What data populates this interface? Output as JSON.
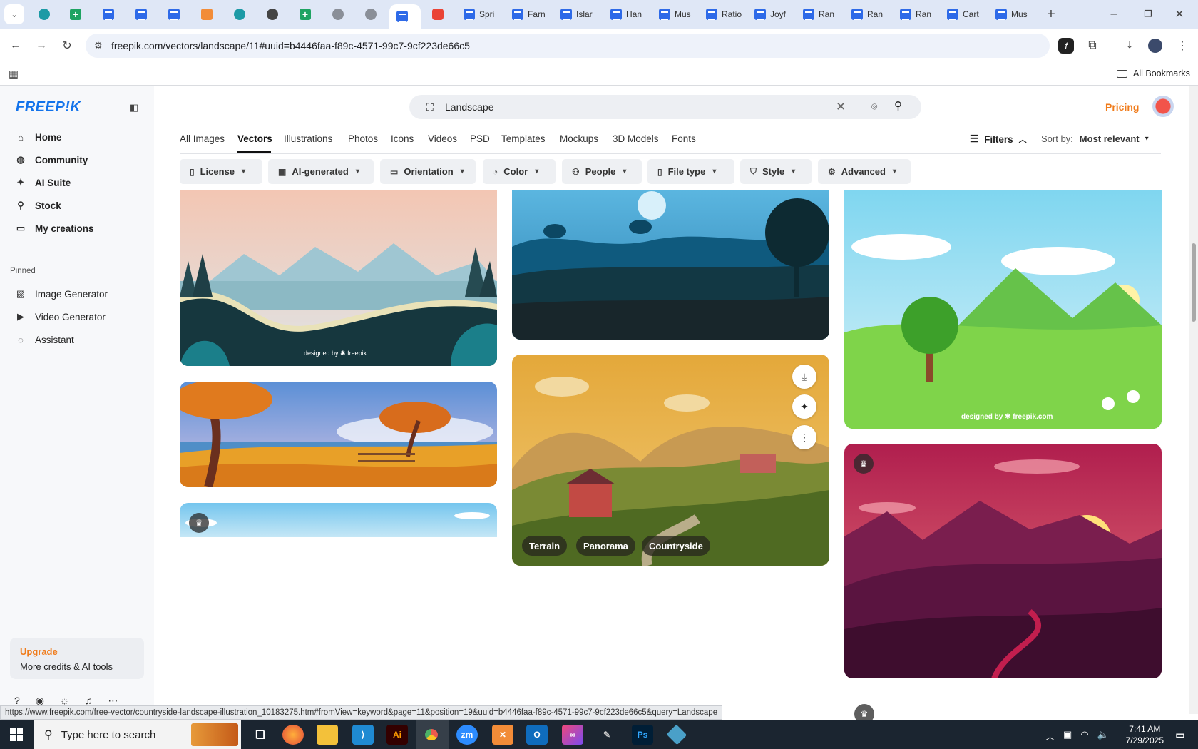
{
  "browser": {
    "tabs": [
      {
        "label": "",
        "icon": "wordpress-icon"
      },
      {
        "label": "",
        "icon": "sheets-icon"
      },
      {
        "label": "",
        "icon": "docs-icon"
      },
      {
        "label": "",
        "icon": "docs-icon"
      },
      {
        "label": "",
        "icon": "docs-icon"
      },
      {
        "label": "",
        "icon": "orange-app-icon"
      },
      {
        "label": "",
        "icon": "teal-app-icon"
      },
      {
        "label": "",
        "icon": "openai-icon"
      },
      {
        "label": "",
        "icon": "sheets-icon"
      },
      {
        "label": "",
        "icon": "globe-icon"
      },
      {
        "label": "",
        "icon": "grid-app-icon"
      },
      {
        "label": "",
        "icon": "freepik-icon"
      },
      {
        "label": "",
        "icon": "youtube-icon"
      },
      {
        "label": "Spri",
        "icon": "docs-icon"
      },
      {
        "label": "Farn",
        "icon": "docs-icon"
      },
      {
        "label": "Islar",
        "icon": "docs-icon"
      },
      {
        "label": "Han",
        "icon": "docs-icon"
      },
      {
        "label": "Mus",
        "icon": "docs-icon"
      },
      {
        "label": "Ratio",
        "icon": "docs-icon"
      },
      {
        "label": "Joyf",
        "icon": "docs-icon"
      },
      {
        "label": "Ran",
        "icon": "docs-icon"
      },
      {
        "label": "Ran",
        "icon": "docs-icon"
      },
      {
        "label": "Ran",
        "icon": "docs-icon"
      },
      {
        "label": "Cart",
        "icon": "docs-icon"
      },
      {
        "label": "Mus",
        "icon": "docs-icon"
      }
    ],
    "url": "freepik.com/vectors/landscape/11#uuid=b4446faa-f89c-4571-99c7-9cf223de66c5",
    "all_bookmarks": "All Bookmarks",
    "status_url": "https://www.freepik.com/free-vector/countryside-landscape-illustration_10183275.htm#fromView=keyword&page=11&position=19&uuid=b4446faa-f89c-4571-99c7-9cf223de66c5&query=Landscape"
  },
  "sidebar": {
    "logo": "FREEP!K",
    "main_items": [
      {
        "label": "Home",
        "icon": "home-icon"
      },
      {
        "label": "Community",
        "icon": "globe-icon"
      },
      {
        "label": "AI Suite",
        "icon": "sparkle-icon"
      },
      {
        "label": "Stock",
        "icon": "search-icon"
      },
      {
        "label": "My creations",
        "icon": "folder-icon"
      }
    ],
    "pinned_heading": "Pinned",
    "pinned_items": [
      {
        "label": "Image Generator",
        "icon": "image-icon"
      },
      {
        "label": "Video Generator",
        "icon": "video-icon"
      },
      {
        "label": "Assistant",
        "icon": "assistant-icon"
      }
    ],
    "upgrade_title": "Upgrade",
    "upgrade_sub": "More credits & AI tools"
  },
  "header": {
    "search_value": "Landscape",
    "pricing": "Pricing"
  },
  "types": [
    "All Images",
    "Vectors",
    "Illustrations",
    "Photos",
    "Icons",
    "Videos",
    "PSD",
    "Templates",
    "Mockups",
    "3D Models",
    "Fonts"
  ],
  "active_type": "Vectors",
  "filters_label": "Filters",
  "sort_label": "Sort by:",
  "sort_value": "Most relevant",
  "chips": [
    "License",
    "AI-generated",
    "Orientation",
    "Color",
    "People",
    "File type",
    "Style",
    "Advanced"
  ],
  "watermarks": {
    "lake": "designed by ✱ freepik",
    "green": "designed by ✱ freepik.com"
  },
  "card_tags": [
    "Terrain",
    "Panorama",
    "Countryside"
  ],
  "taskbar": {
    "search_placeholder": "Type here to search",
    "time": "7:41 AM",
    "date": "7/29/2025"
  },
  "colors": {
    "brand": "#1273eb",
    "accent": "#f07b1a"
  }
}
